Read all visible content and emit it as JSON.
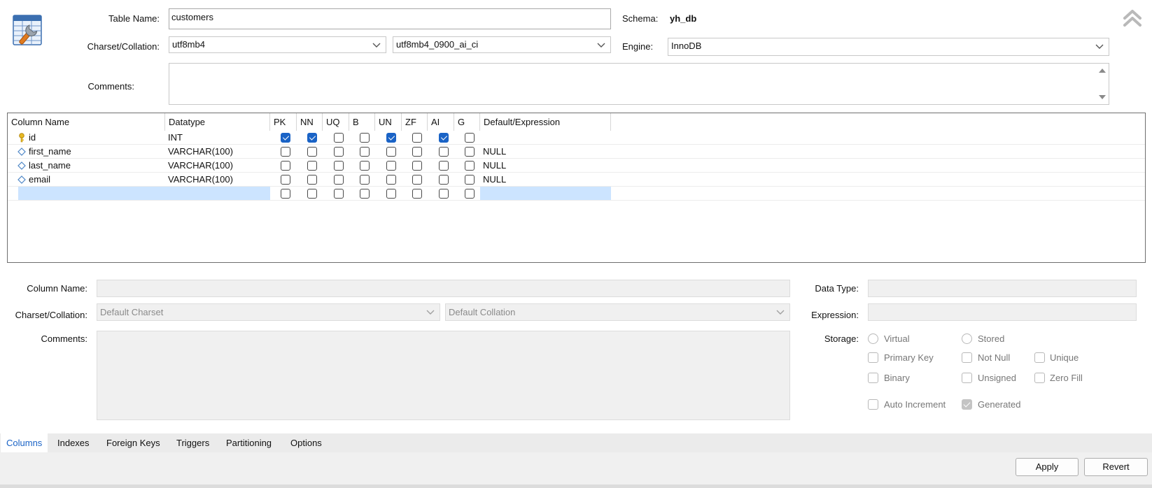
{
  "header": {
    "table_name_label": "Table Name:",
    "table_name_value": "customers",
    "schema_label": "Schema:",
    "schema_value": "yh_db",
    "charset_label": "Charset/Collation:",
    "charset_value": "utf8mb4",
    "collation_value": "utf8mb4_0900_ai_ci",
    "engine_label": "Engine:",
    "engine_value": "InnoDB",
    "comments_label": "Comments:",
    "comments_value": "",
    "table_icon": "table-edit-icon",
    "collapse_icon": "double-chevron-up-icon"
  },
  "grid": {
    "headers": {
      "column_name": "Column Name",
      "datatype": "Datatype",
      "pk": "PK",
      "nn": "NN",
      "uq": "UQ",
      "b": "B",
      "un": "UN",
      "zf": "ZF",
      "ai": "AI",
      "g": "G",
      "default": "Default/Expression"
    },
    "rows": [
      {
        "name": "id",
        "datatype": "INT",
        "default": "",
        "icon": "primary-key-icon",
        "flags": [
          true,
          true,
          false,
          false,
          true,
          false,
          true,
          false
        ]
      },
      {
        "name": "first_name",
        "datatype": "VARCHAR(100)",
        "default": "NULL",
        "icon": "column-diamond-icon",
        "flags": [
          false,
          false,
          false,
          false,
          false,
          false,
          false,
          false
        ]
      },
      {
        "name": "last_name",
        "datatype": "VARCHAR(100)",
        "default": "NULL",
        "icon": "column-diamond-icon",
        "flags": [
          false,
          false,
          false,
          false,
          false,
          false,
          false,
          false
        ]
      },
      {
        "name": "email",
        "datatype": "VARCHAR(100)",
        "default": "NULL",
        "icon": "column-diamond-icon",
        "flags": [
          false,
          false,
          false,
          false,
          false,
          false,
          false,
          false
        ]
      },
      {
        "name": "",
        "datatype": "",
        "default": "",
        "icon": "",
        "flags": [
          false,
          false,
          false,
          false,
          false,
          false,
          false,
          false
        ]
      }
    ]
  },
  "details": {
    "column_name_label": "Column Name:",
    "charset_label": "Charset/Collation:",
    "charset_placeholder": "Default Charset",
    "collation_placeholder": "Default Collation",
    "comments_label": "Comments:",
    "data_type_label": "Data Type:",
    "expression_label": "Expression:",
    "storage_label": "Storage:",
    "virtual_label": "Virtual",
    "stored_label": "Stored",
    "primary_key_label": "Primary Key",
    "not_null_label": "Not Null",
    "unique_label": "Unique",
    "binary_label": "Binary",
    "unsigned_label": "Unsigned",
    "zero_fill_label": "Zero Fill",
    "auto_increment_label": "Auto Increment",
    "generated_label": "Generated"
  },
  "tabs": [
    "Columns",
    "Indexes",
    "Foreign Keys",
    "Triggers",
    "Partitioning",
    "Options"
  ],
  "active_tab": "Columns",
  "buttons": {
    "apply": "Apply",
    "revert": "Revert"
  },
  "colors": {
    "accent": "#1a63c6",
    "selection": "#cce4ff",
    "tabbar": "#ebebeb"
  }
}
